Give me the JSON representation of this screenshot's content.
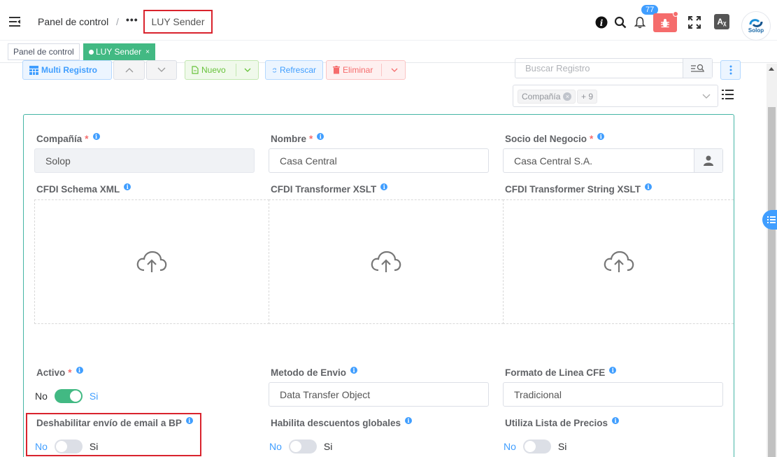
{
  "header": {
    "breadcrumb_home": "Panel de control",
    "breadcrumb_sep": "/",
    "breadcrumb_more": "•••",
    "breadcrumb_current": "LUY Sender",
    "notification_count": "77",
    "lang_label": "Aᵪ",
    "avatar_label": "Solop",
    "icons": [
      "menu-fold-icon",
      "info-icon",
      "search-icon",
      "bell-icon",
      "bug-icon",
      "fullscreen-icon",
      "translate-icon",
      "solop-logo"
    ]
  },
  "tabs": [
    {
      "label": "Panel de control",
      "active": false
    },
    {
      "label": "LUY Sender",
      "active": true,
      "close": "×"
    }
  ],
  "toolbar": {
    "multi_record": "Multi Registro",
    "new": "Nuevo",
    "refresh": "Refrescar",
    "delete": "Eliminar",
    "search_placeholder": "Buscar Registro",
    "filter_chip": "Compañía",
    "filter_more": "+ 9"
  },
  "form": {
    "company": {
      "label": "Compañía",
      "required": "*",
      "value": "Solop"
    },
    "name": {
      "label": "Nombre",
      "required": "*",
      "value": "Casa Central"
    },
    "business_partner": {
      "label": "Socio del Negocio",
      "required": "*",
      "value": "Casa Central S.A."
    },
    "cfdi_schema": {
      "label": "CFDI Schema XML"
    },
    "cfdi_transformer": {
      "label": "CFDI Transformer XSLT"
    },
    "cfdi_transformer_string": {
      "label": "CFDI Transformer String XSLT"
    },
    "active": {
      "label": "Activo",
      "required": "*",
      "off": "No",
      "on": "Si",
      "value": true
    },
    "send_method": {
      "label": "Metodo de Envio",
      "value": "Data Transfer Object"
    },
    "line_format": {
      "label": "Formato de Linea CFE",
      "value": "Tradicional"
    },
    "disable_email": {
      "label": "Deshabilitar envío de email a BP",
      "off": "No",
      "on": "Si",
      "value": false
    },
    "global_discounts": {
      "label": "Habilita descuentos globales",
      "off": "No",
      "on": "Si",
      "value": false
    },
    "price_list": {
      "label": "Utiliza Lista de Precios",
      "off": "No",
      "on": "Si",
      "value": false
    }
  },
  "colors": {
    "primary": "#409eff",
    "success": "#42b983",
    "danger": "#f56c6c",
    "highlight": "#d9232d"
  }
}
